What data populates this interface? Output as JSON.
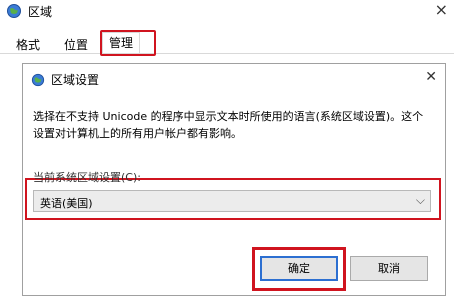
{
  "window": {
    "title": "区域",
    "icon": "globe-icon",
    "close_label": "×"
  },
  "tabs": [
    {
      "label": "格式"
    },
    {
      "label": "位置"
    },
    {
      "label": "管理"
    }
  ],
  "dialog": {
    "title": "区域设置",
    "icon": "globe-icon",
    "close_label": "✕",
    "description": "选择在不支持 Unicode 的程序中显示文本时所使用的语言(系统区域设置)。这个设置对计算机上的所有用户帐户都有影响。",
    "field_label": "当前系统区域设置(C):",
    "select_value": "英语(美国)",
    "ok_label": "确定",
    "cancel_label": "取消"
  },
  "highlight_color": "#d0141f"
}
